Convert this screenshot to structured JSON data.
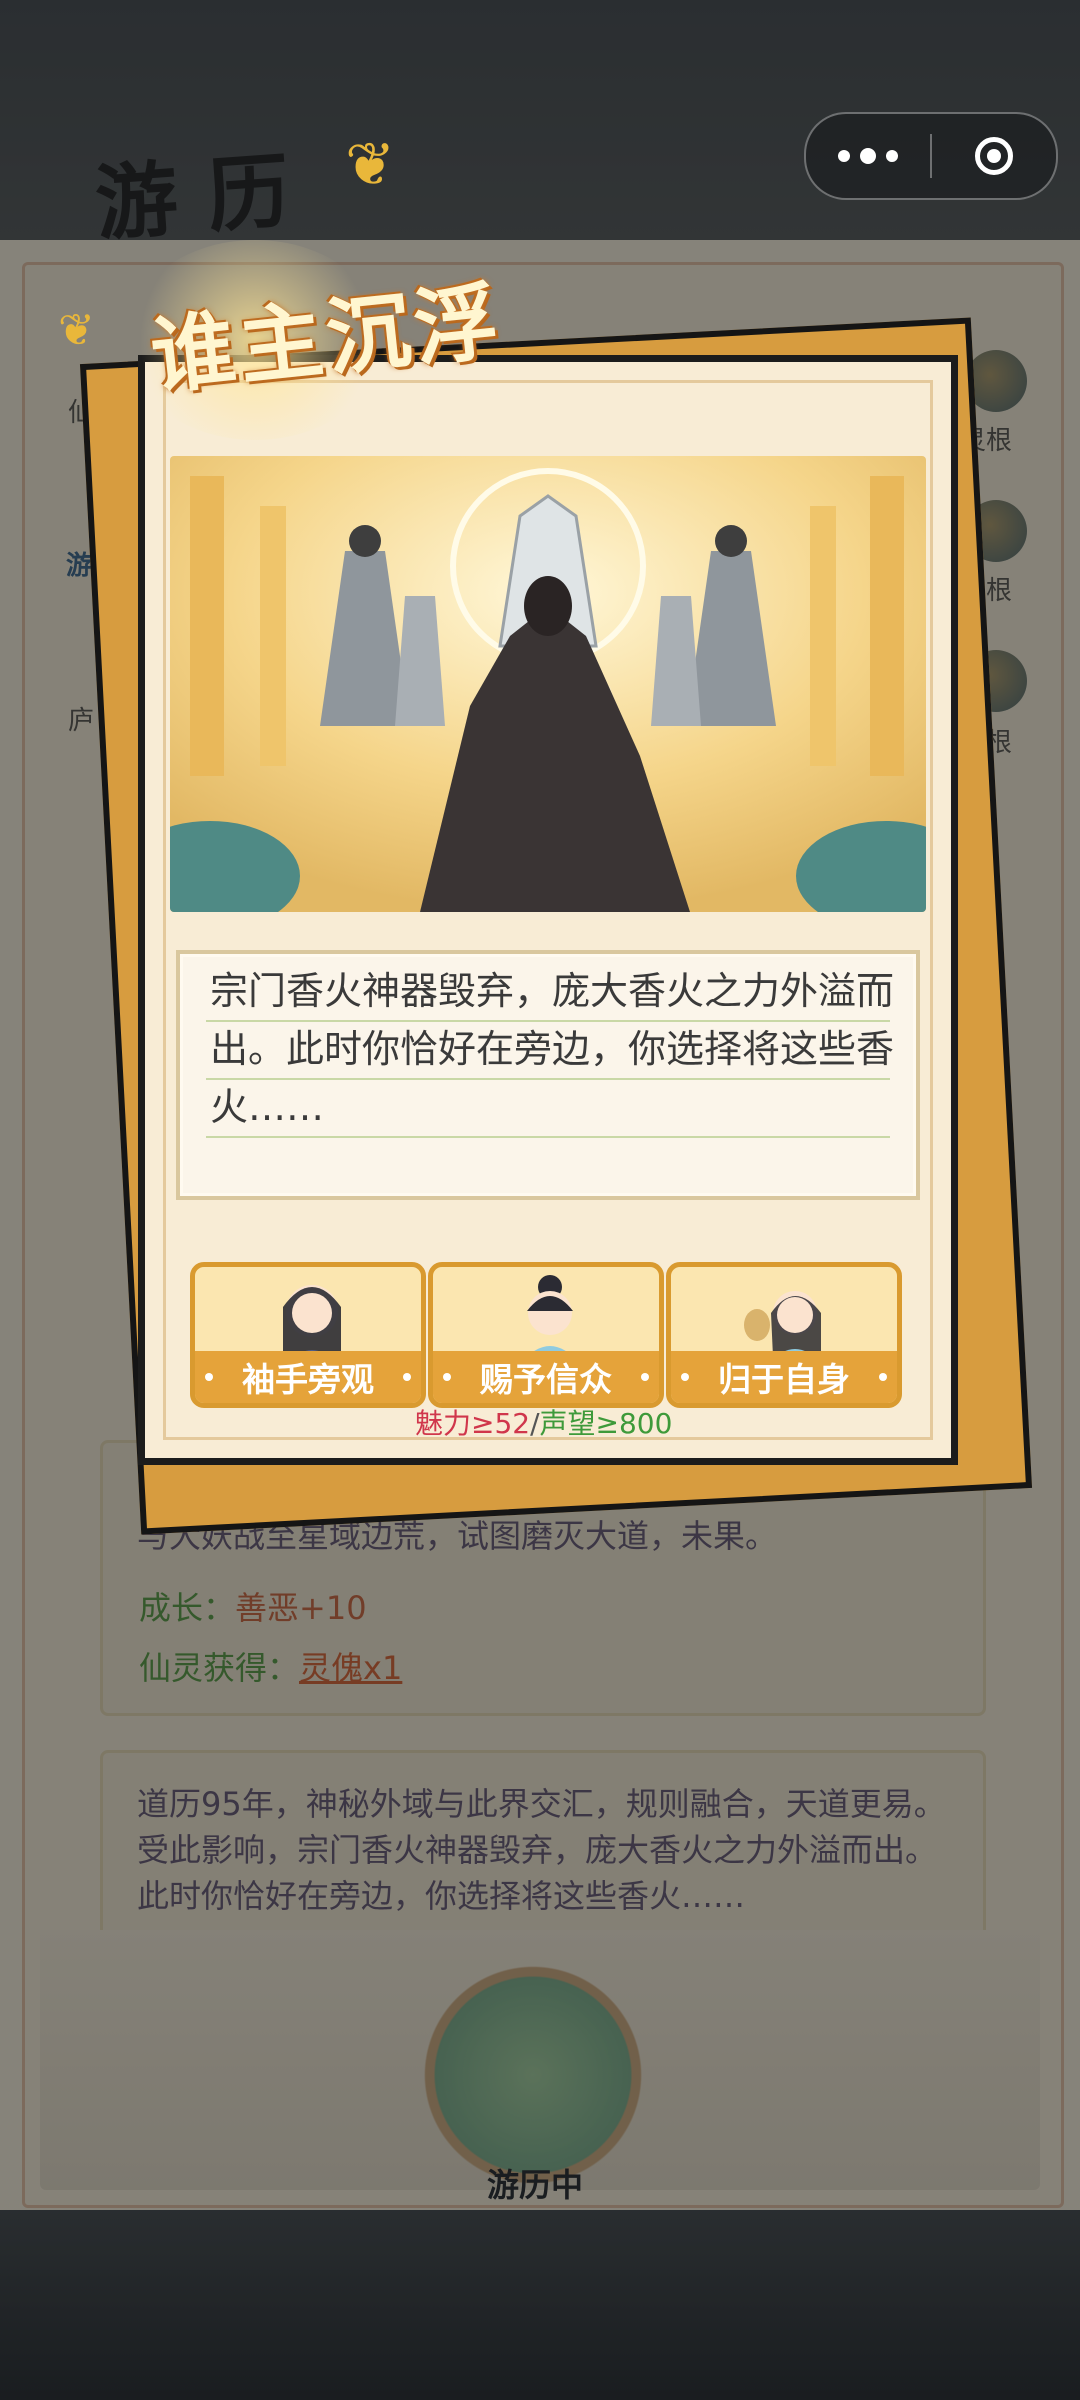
{
  "window": {
    "capsule": {
      "menu_icon": "more-dots-icon",
      "close_icon": "target-circle-icon"
    }
  },
  "background": {
    "title": "游历",
    "side_labels": [
      "灵根",
      "灵根",
      "灵根"
    ],
    "left_labels": [
      "仙",
      "游",
      "庐"
    ],
    "cards": [
      {
        "lines": [
          "与大妖战至星域边荒，试图磨灭大道，未果。"
        ],
        "growth_label": "成长：",
        "growth_value": "善恶+10",
        "spirit_label": "仙灵获得：",
        "spirit_value": "灵傀x1"
      },
      {
        "text": "道历95年，神秘外域与此界交汇，规则融合，天道更易。受此影响，宗门香火神器毁弃，庞大香火之力外溢而出。此时你恰好在旁边，你选择将这些香火……"
      }
    ],
    "status": "游历中"
  },
  "event": {
    "title": "谁主沉浮",
    "description": "宗门香火神器毁弃，庞大香火之力外溢而出。此时你恰好在旁边，你选择将这些香火……",
    "options": [
      {
        "label": "袖手旁观"
      },
      {
        "label": "赐予信众"
      },
      {
        "label": "归于自身"
      }
    ],
    "requirement": {
      "charm_text": "魅力≥52",
      "separator": "/",
      "fame_text": "声望≥800",
      "charm_color": "#d0364b",
      "fame_color": "#3e9a3a"
    }
  }
}
